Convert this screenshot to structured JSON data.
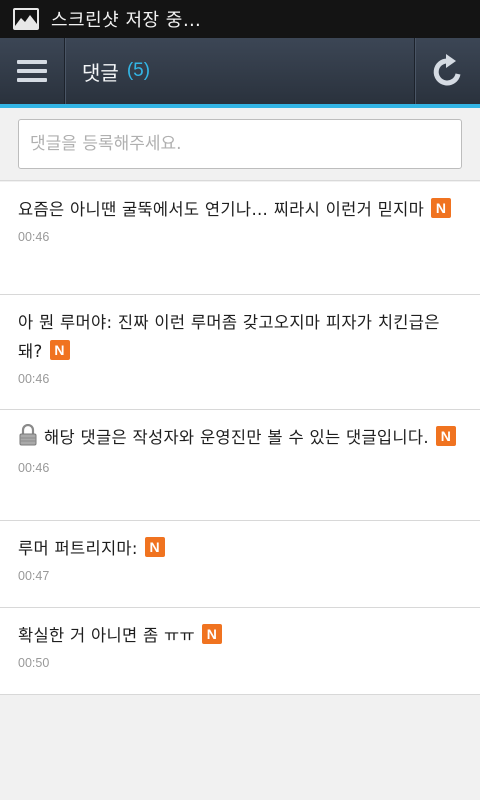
{
  "status_bar": {
    "icon": "image-icon",
    "text": "스크린샷 저장 중…"
  },
  "app_bar": {
    "title": "댓글",
    "count": "(5)",
    "menu_icon": "menu-icon",
    "refresh_icon": "refresh-icon"
  },
  "colors": {
    "accent": "#33b5e5",
    "badge": "#f07320",
    "appbar": "#2f3843"
  },
  "input": {
    "placeholder": "댓글을 등록해주세요."
  },
  "comments": [
    {
      "text": "요즘은 아니땐 굴뚝에서도 연기나… 찌라시 이런거 믿지마",
      "badge": "N",
      "time": "00:46",
      "locked": false
    },
    {
      "text": "아 뭔 루머야: 진짜 이런 루머좀 갖고오지마 피자가 치킨급은 돼?",
      "badge": "N",
      "time": "00:46",
      "locked": false
    },
    {
      "text": "해당 댓글은 작성자와 운영진만 볼 수 있는 댓글입니다.",
      "badge": "N",
      "time": "00:46",
      "locked": true
    },
    {
      "text": "루머 퍼트리지마:",
      "badge": "N",
      "time": "00:47",
      "locked": false
    },
    {
      "text": "확실한 거 아니면 좀 ㅠㅠ",
      "badge": "N",
      "time": "00:50",
      "locked": false
    }
  ]
}
